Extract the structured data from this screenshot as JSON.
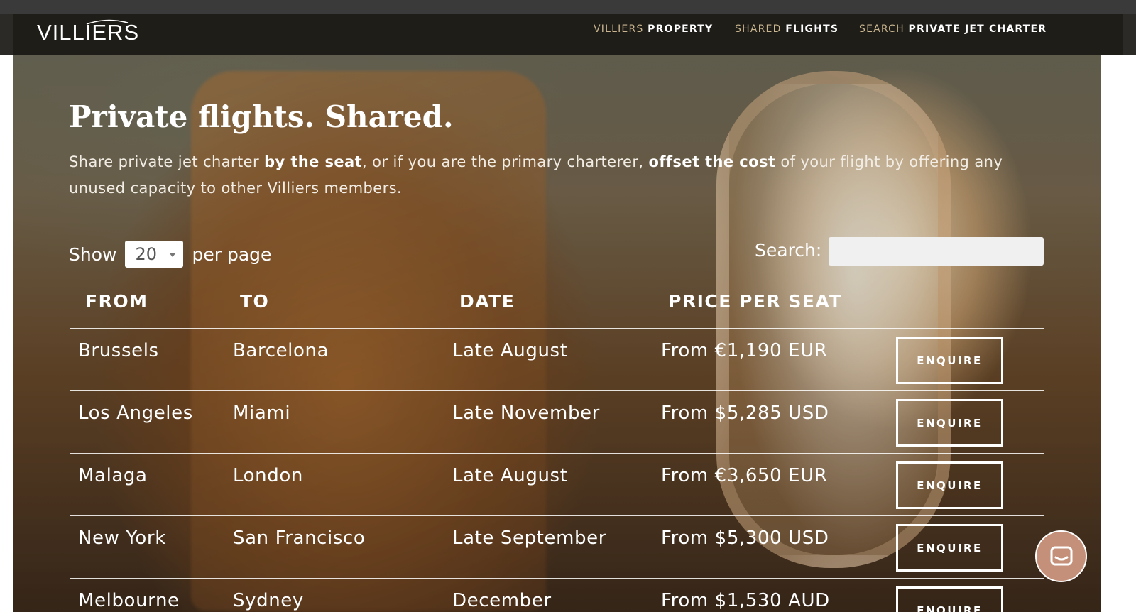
{
  "header": {
    "logo": "VILLIERS",
    "nav": [
      {
        "prefix": "VILLIERS",
        "label": "PROPERTY"
      },
      {
        "prefix": "SHARED",
        "label": "FLIGHTS"
      },
      {
        "prefix": "SEARCH",
        "label": "PRIVATE JET CHARTER"
      }
    ]
  },
  "hero": {
    "title_light": "Private flights. ",
    "title_bold": "Shared.",
    "desc_1": "Share private jet charter ",
    "desc_bold_1": "by the seat",
    "desc_2": ", or if you are the primary charterer, ",
    "desc_bold_2": "offset the cost",
    "desc_3": " of your flight by offering any unused capacity to other Villiers members."
  },
  "controls": {
    "show_label": "Show",
    "per_page_value": "20",
    "per_page_label": "per page",
    "search_label": "Search:",
    "search_value": ""
  },
  "table": {
    "headers": [
      "FROM",
      "TO",
      "DATE",
      "PRICE PER SEAT"
    ],
    "enquire_label": "ENQUIRE",
    "rows": [
      {
        "from": "Brussels",
        "to": "Barcelona",
        "date": "Late August",
        "price": "From €1,190 EUR"
      },
      {
        "from": "Los Angeles",
        "to": "Miami",
        "date": "Late November",
        "price": "From $5,285 USD"
      },
      {
        "from": "Malaga",
        "to": "London",
        "date": "Late August",
        "price": "From €3,650 EUR"
      },
      {
        "from": "New York",
        "to": "San Francisco",
        "date": "Late September",
        "price": "From $5,300 USD"
      },
      {
        "from": "Melbourne",
        "to": "Sydney",
        "date": "December",
        "price": "From $1,530 AUD"
      }
    ]
  },
  "icons": {
    "chat": "chat-icon",
    "dropdown": "chevron-down-icon"
  },
  "colors": {
    "topbar": "#19180f",
    "nav_dim": "#c9b58f",
    "chat_bubble": "#c5907a"
  }
}
